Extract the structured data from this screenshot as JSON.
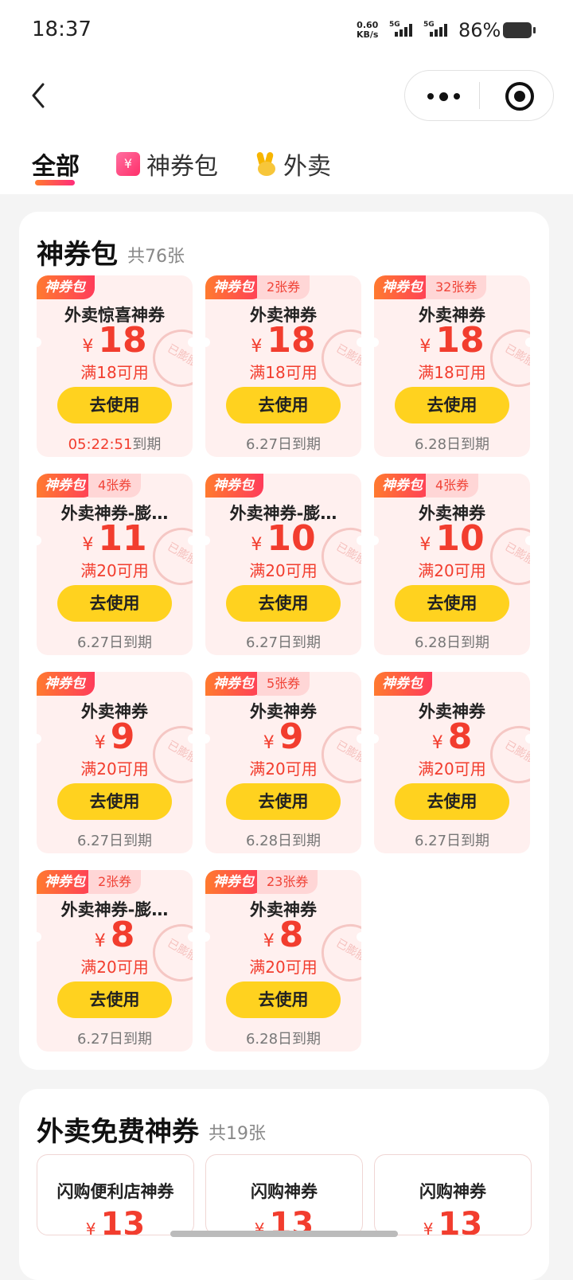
{
  "status_bar": {
    "time": "18:37",
    "net_speed": "0.60",
    "net_unit": "KB/s",
    "sim1": "5G",
    "sim2": "5G",
    "battery": "86%"
  },
  "tabs": [
    {
      "label": "全部",
      "active": true
    },
    {
      "label": "神券包",
      "icon": "coupon-pack-icon"
    },
    {
      "label": "外卖",
      "icon": "waimai-rabbit-icon"
    }
  ],
  "pack_section": {
    "title": "神券包",
    "count": "共76张",
    "coupons": [
      {
        "tag": "神券包",
        "qty": "",
        "name": "外卖惊喜神券",
        "currency": "¥",
        "amount": "18",
        "condition": "满18可用",
        "button": "去使用",
        "expiry": "到期",
        "countdown": "05:22:51",
        "stamp": "已膨胀"
      },
      {
        "tag": "神券包",
        "qty": "2张券",
        "name": "外卖神券",
        "currency": "¥",
        "amount": "18",
        "condition": "满18可用",
        "button": "去使用",
        "expiry": "6.27日到期",
        "stamp": "已膨胀"
      },
      {
        "tag": "神券包",
        "qty": "32张券",
        "name": "外卖神券",
        "currency": "¥",
        "amount": "18",
        "condition": "满18可用",
        "button": "去使用",
        "expiry": "6.28日到期",
        "stamp": "已膨胀"
      },
      {
        "tag": "神券包",
        "qty": "4张券",
        "name": "外卖神券-膨…",
        "currency": "¥",
        "amount": "11",
        "condition": "满20可用",
        "button": "去使用",
        "expiry": "6.27日到期",
        "stamp": "已膨胀"
      },
      {
        "tag": "神券包",
        "qty": "",
        "name": "外卖神券-膨…",
        "currency": "¥",
        "amount": "10",
        "condition": "满20可用",
        "button": "去使用",
        "expiry": "6.27日到期",
        "stamp": "已膨胀"
      },
      {
        "tag": "神券包",
        "qty": "4张券",
        "name": "外卖神券",
        "currency": "¥",
        "amount": "10",
        "condition": "满20可用",
        "button": "去使用",
        "expiry": "6.28日到期",
        "stamp": "已膨胀"
      },
      {
        "tag": "神券包",
        "qty": "",
        "name": "外卖神券",
        "currency": "¥",
        "amount": "9",
        "condition": "满20可用",
        "button": "去使用",
        "expiry": "6.27日到期",
        "stamp": "已膨胀"
      },
      {
        "tag": "神券包",
        "qty": "5张券",
        "name": "外卖神券",
        "currency": "¥",
        "amount": "9",
        "condition": "满20可用",
        "button": "去使用",
        "expiry": "6.28日到期",
        "stamp": "已膨胀"
      },
      {
        "tag": "神券包",
        "qty": "",
        "name": "外卖神券",
        "currency": "¥",
        "amount": "8",
        "condition": "满20可用",
        "button": "去使用",
        "expiry": "6.27日到期",
        "stamp": "已膨胀"
      },
      {
        "tag": "神券包",
        "qty": "2张券",
        "name": "外卖神券-膨…",
        "currency": "¥",
        "amount": "8",
        "condition": "满20可用",
        "button": "去使用",
        "expiry": "6.27日到期",
        "stamp": "已膨胀"
      },
      {
        "tag": "神券包",
        "qty": "23张券",
        "name": "外卖神券",
        "currency": "¥",
        "amount": "8",
        "condition": "满20可用",
        "button": "去使用",
        "expiry": "6.28日到期",
        "stamp": "已膨胀"
      }
    ]
  },
  "free_section": {
    "title": "外卖免费神券",
    "count": "共19张",
    "coupons": [
      {
        "name": "闪购便利店神券",
        "currency": "¥",
        "amount": "13"
      },
      {
        "name": "闪购神券",
        "currency": "¥",
        "amount": "13"
      },
      {
        "name": "闪购神券",
        "currency": "¥",
        "amount": "13"
      }
    ]
  }
}
